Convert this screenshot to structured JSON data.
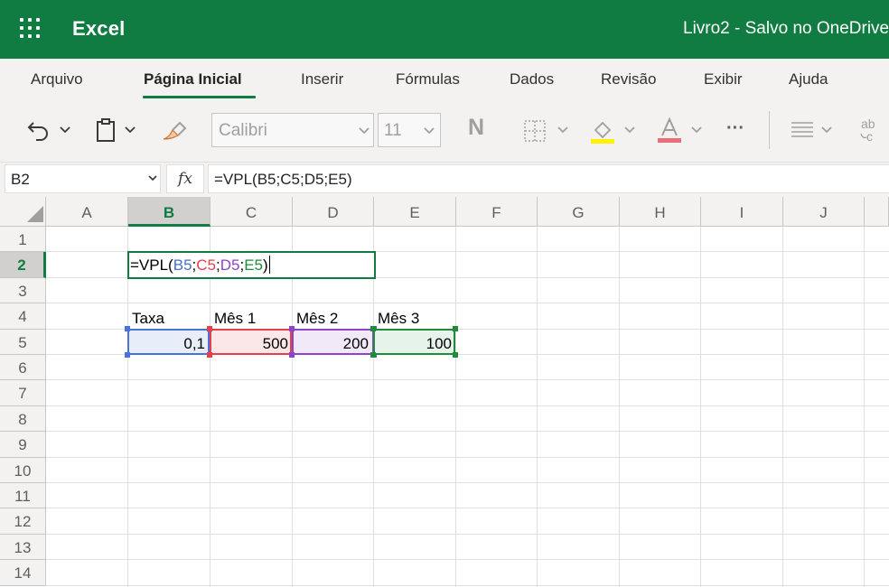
{
  "app": {
    "name": "Excel",
    "document_title": "Livro2  -  Salvo no OneDrive"
  },
  "menu": {
    "tabs": [
      {
        "label": "Arquivo"
      },
      {
        "label": "Página Inicial"
      },
      {
        "label": "Inserir"
      },
      {
        "label": "Fórmulas"
      },
      {
        "label": "Dados"
      },
      {
        "label": "Revisão"
      },
      {
        "label": "Exibir"
      },
      {
        "label": "Ajuda"
      }
    ],
    "active_tab": "Página Inicial"
  },
  "ribbon": {
    "font_name": "Calibri",
    "font_size": "11",
    "bold_label": "N",
    "more_label": "···",
    "fill_color": "#fff100",
    "font_color": "#e8707a"
  },
  "formula_bar": {
    "name_box": "B2",
    "fx_label": "fx",
    "formula": "=VPL(B5;C5;D5;E5)"
  },
  "grid": {
    "columns": [
      "A",
      "B",
      "C",
      "D",
      "E",
      "F",
      "G",
      "H",
      "I",
      "J"
    ],
    "rows": [
      "1",
      "2",
      "3",
      "4",
      "5",
      "6",
      "7",
      "8",
      "9",
      "10",
      "11",
      "12",
      "13",
      "14"
    ],
    "selected_column": "B",
    "selected_row": "2",
    "cells": {
      "B4": "Taxa",
      "C4": "Mês 1",
      "D4": "Mês 2",
      "E4": "Mês 3",
      "B5": "0,1",
      "C5": "500",
      "D5": "200",
      "E5": "100"
    },
    "edit_cell": {
      "address": "B2",
      "parts": [
        {
          "text": "=VPL(",
          "color": "#000000"
        },
        {
          "text": "B5",
          "color": "#4472c4"
        },
        {
          "text": ";",
          "color": "#000000"
        },
        {
          "text": "C5",
          "color": "#e5414b"
        },
        {
          "text": ";",
          "color": "#000000"
        },
        {
          "text": "D5",
          "color": "#8e44c6"
        },
        {
          "text": ";",
          "color": "#000000"
        },
        {
          "text": "E5",
          "color": "#1e8c3a"
        },
        {
          "text": ")",
          "color": "#000000"
        }
      ]
    },
    "reference_colors": {
      "B5": {
        "border": "#4a72d8",
        "fill": "#e8edfa"
      },
      "C5": {
        "border": "#e5414b",
        "fill": "#fbe7e8"
      },
      "D5": {
        "border": "#8e44c6",
        "fill": "#f1e8f8"
      },
      "E5": {
        "border": "#1e8c3a",
        "fill": "#e6f3ea"
      }
    }
  }
}
